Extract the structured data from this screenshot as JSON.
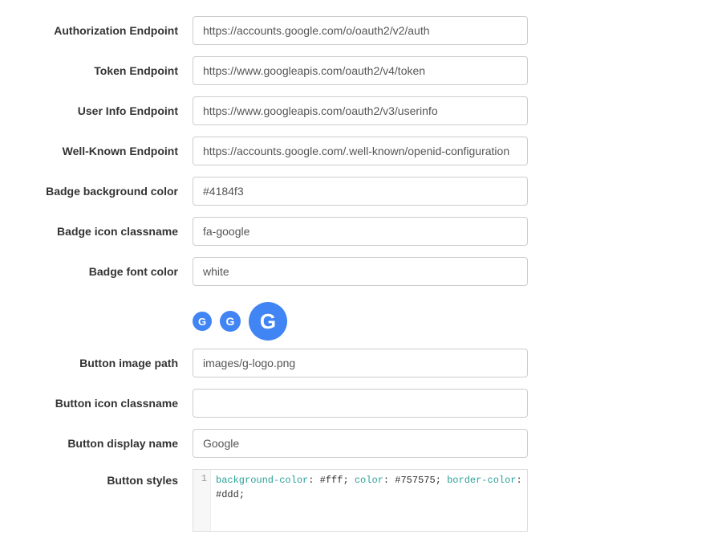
{
  "fields": {
    "authorization_endpoint": {
      "label": "Authorization Endpoint",
      "value": "https://accounts.google.com/o/oauth2/v2/auth"
    },
    "token_endpoint": {
      "label": "Token Endpoint",
      "value": "https://www.googleapis.com/oauth2/v4/token"
    },
    "user_info_endpoint": {
      "label": "User Info Endpoint",
      "value": "https://www.googleapis.com/oauth2/v3/userinfo"
    },
    "well_known_endpoint": {
      "label": "Well-Known Endpoint",
      "value": "https://accounts.google.com/.well-known/openid-configuration"
    },
    "badge_bg_color": {
      "label": "Badge background color",
      "value": "#4184f3"
    },
    "badge_icon_classname": {
      "label": "Badge icon classname",
      "value": "fa-google"
    },
    "badge_font_color": {
      "label": "Badge font color",
      "value": "white"
    },
    "button_image_path": {
      "label": "Button image path",
      "value": "images/g-logo.png"
    },
    "button_icon_classname": {
      "label": "Button icon classname",
      "value": ""
    },
    "button_display_name": {
      "label": "Button display name",
      "value": "Google"
    },
    "button_styles": {
      "label": "Button styles",
      "value": "background-color: #fff; color: #757575; border-color: #ddd;"
    }
  },
  "badge_preview": {
    "glyph": "G",
    "bg": "#4184f3",
    "color": "white"
  },
  "code_gutter": "1"
}
